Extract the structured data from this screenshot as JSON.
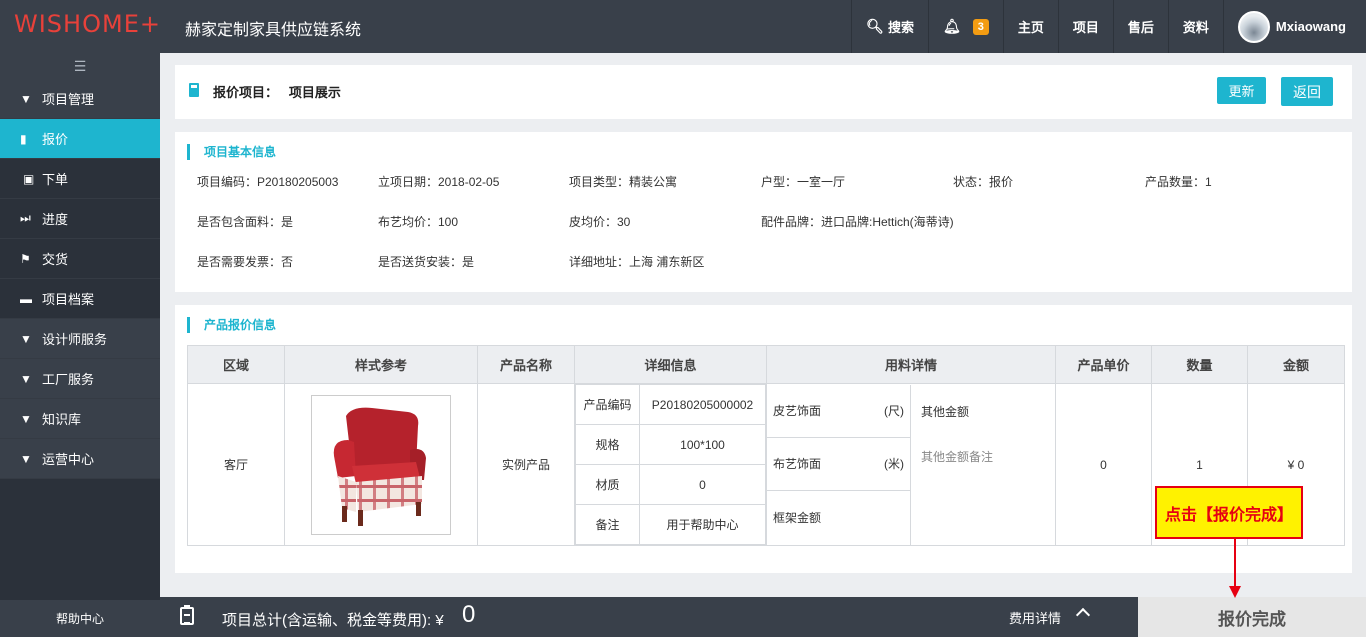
{
  "topbar": {
    "logo": "WISHOME+",
    "system_title": "赫家定制家具供应链系统",
    "search": "搜索",
    "notification_count": "3",
    "nav": [
      "主页",
      "项目",
      "售后",
      "资料"
    ],
    "username": "Mxiaowang"
  },
  "sidebar": {
    "items": [
      {
        "label": "项目管理",
        "icon": "caret-down-icon"
      },
      {
        "label": "报价",
        "icon": "document-icon"
      },
      {
        "label": "下单",
        "icon": "calendar-icon"
      },
      {
        "label": "进度",
        "icon": "fast-forward-icon"
      },
      {
        "label": "交货",
        "icon": "flag-icon"
      },
      {
        "label": "项目档案",
        "icon": "folder-icon"
      },
      {
        "label": "设计师服务",
        "icon": "caret-down-icon"
      },
      {
        "label": "工厂服务",
        "icon": "caret-down-icon"
      },
      {
        "label": "知识库",
        "icon": "caret-down-icon"
      },
      {
        "label": "运营中心",
        "icon": "caret-down-icon"
      }
    ],
    "help": "帮助中心"
  },
  "header": {
    "title": "报价项目：   项目展示",
    "update_label": "更新",
    "back_label": "返回"
  },
  "basic_info": {
    "section_title": "项目基本信息",
    "fields": [
      "项目编码：P20180205003",
      "立项日期：2018-02-05",
      "项目类型：精装公寓",
      "户型：一室一厅",
      "状态：报价",
      "产品数量：1",
      "是否包含面料：是",
      "布艺均价：100",
      "皮均价：30",
      "配件品牌：进口品牌:Hettich(海蒂诗)",
      "是否需要发票：否",
      "是否送货安装：是",
      "详细地址：上海 浦东新区"
    ]
  },
  "product_info": {
    "section_title": "产品报价信息",
    "columns": [
      "区域",
      "样式参考",
      "产品名称",
      "详细信息",
      "用料详情",
      "产品单价",
      "数量",
      "金额"
    ],
    "row": {
      "area": "客厅",
      "product_name": "实例产品",
      "details": [
        {
          "k": "产品编码",
          "v": "P20180205000002"
        },
        {
          "k": "规格",
          "v": "100*100"
        },
        {
          "k": "材质",
          "v": "0"
        },
        {
          "k": "备注",
          "v": "用于帮助中心"
        }
      ],
      "materials": [
        {
          "name": "皮艺饰面",
          "unit": "(尺)"
        },
        {
          "name": "布艺饰面",
          "unit": "(米)"
        },
        {
          "name": "框架金额",
          "unit": ""
        }
      ],
      "other_amount": "其他金额",
      "other_note": "其他金额备注",
      "unit_price": "0",
      "quantity": "1",
      "amount": "¥ 0"
    }
  },
  "footer": {
    "total_label": "项目总计(含运输、税金等费用): ¥",
    "total_value": "0",
    "fee_detail": "费用详情",
    "finish_label": "报价完成"
  },
  "callout": "点击【报价完成】",
  "colors": {
    "accent": "#1eb5cf",
    "topbar": "#39404a",
    "logo": "#e8413a",
    "callout_bg": "#fff200",
    "callout_border": "#e60012"
  }
}
